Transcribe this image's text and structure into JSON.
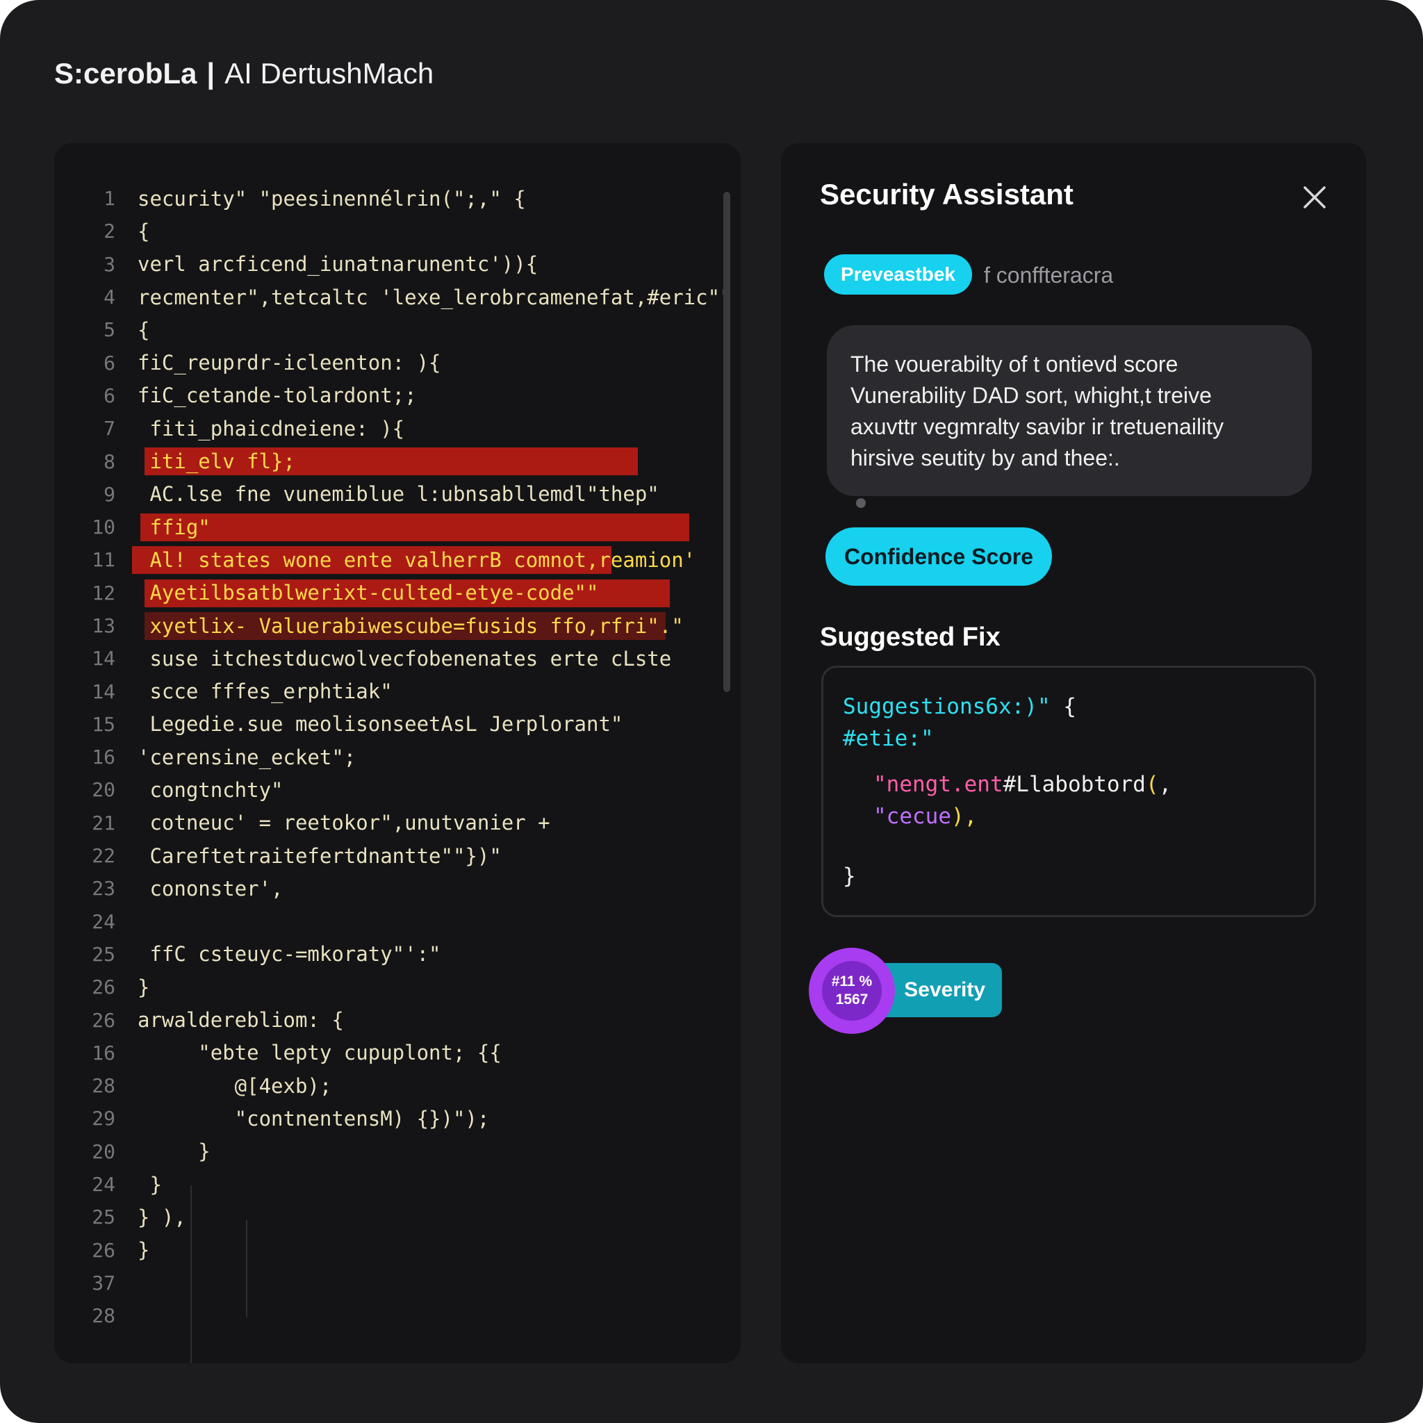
{
  "window": {
    "brand": "S:cerobLa",
    "separator": "|",
    "product": "AI DertushMach"
  },
  "colors": {
    "background": "#1c1c1e",
    "panel": "#141416",
    "accent_cyan": "#17d1ee",
    "highlight_red": "#d61e14",
    "severity_purple": "#a83cf0",
    "code_text": "#e8e2c0"
  },
  "code_editor": {
    "lines": [
      {
        "num": "1",
        "text": "security\" \"peesinennélrin(\";,\" {"
      },
      {
        "num": "2",
        "text": "{"
      },
      {
        "num": "3",
        "text": "verl arcficend_iunatnarunentc')){"
      },
      {
        "num": "4",
        "text": "recmenter\",tetcaltc 'lexe_lerobrcamenefat,#eric\"\""
      },
      {
        "num": "5",
        "text": "{"
      },
      {
        "num": "6",
        "text": "fiC_reuprdr-icleenton: ){"
      },
      {
        "num": "6",
        "text": "fiC_cetande-tolardont;;"
      },
      {
        "num": "7",
        "text": " fiti_phaicdneiene: ){"
      },
      {
        "num": "8",
        "text": " iti_elv fl};"
      },
      {
        "num": "9",
        "text": " AC.lse fne vunemiblue l:ubnsabllemdl\"thep\""
      },
      {
        "num": "10",
        "text": " ffig\""
      },
      {
        "num": "11",
        "text": " Al! states wone ente valherrB comnot,reamion'"
      },
      {
        "num": "12",
        "text": " Ayetilbsatblwerixt-culted-etye-code\"\""
      },
      {
        "num": "13",
        "text": " xyetlix- Valuerabiwescube=fusids ffo,rfri\".\""
      },
      {
        "num": "14",
        "text": " suse itchestducwolvecfobenenates erte cLste"
      },
      {
        "num": "14",
        "text": " scce fffes_erphtiak\""
      },
      {
        "num": "15",
        "text": " Legedie.sue meolisonseetAsL Jerplorant\""
      },
      {
        "num": "16",
        "text": "'cerensine_ecket\";"
      },
      {
        "num": "20",
        "text": " congtnchty\""
      },
      {
        "num": "21",
        "text": " cotneuc' = reetokor\",unutvanier +"
      },
      {
        "num": "22",
        "text": " Careftetraitefertdnantte\"\"})\""
      },
      {
        "num": "23",
        "text": " cononster',"
      },
      {
        "num": "24",
        "text": ""
      },
      {
        "num": "25",
        "text": " ffC csteuyc-=mkoraty\"':\""
      },
      {
        "num": "26",
        "text": "}"
      },
      {
        "num": "26",
        "text": "arwalderebliom: {"
      },
      {
        "num": "16",
        "text": "     \"ebte lepty cupuplont; {{"
      },
      {
        "num": "28",
        "text": "        @[4exb);"
      },
      {
        "num": "29",
        "text": "        \"contnentensM) {})\");"
      },
      {
        "num": "20",
        "text": "     }"
      },
      {
        "num": "24",
        "text": " }"
      },
      {
        "num": "25",
        "text": "} ),"
      },
      {
        "num": "26",
        "text": "}"
      },
      {
        "num": "37",
        "text": ""
      },
      {
        "num": "28",
        "text": ""
      }
    ]
  },
  "assistant": {
    "title": "Security Assistant",
    "close_icon": "close-icon",
    "tag_label": "Preveastbek",
    "tag_side_text": "f conffteracra",
    "message_lines": [
      "The vouerabilty of t ontievd score",
      "Vunerability DAD sort, whight,t treive",
      "axuvttr vegmralty savibr ir tretuenaility",
      "hirsive seutity by and thee:."
    ],
    "confidence_label": "Confidence Score",
    "suggested_fix_heading": "Suggested Fix",
    "fix_code": {
      "line1_a": "Suggestions6x:)\"",
      "line1_b": " {",
      "line2": "#etie:\"",
      "line3_a": "\"nengt.ent",
      "line3_b": "#Llabobtord",
      "line3_c": "(",
      "line3_d": ",",
      "line4_a": "\"cecue",
      "line4_b": "),",
      "line5": "}"
    },
    "severity_badge_top": "#11 %",
    "severity_badge_bottom": "1567",
    "severity_label": "Severity"
  }
}
